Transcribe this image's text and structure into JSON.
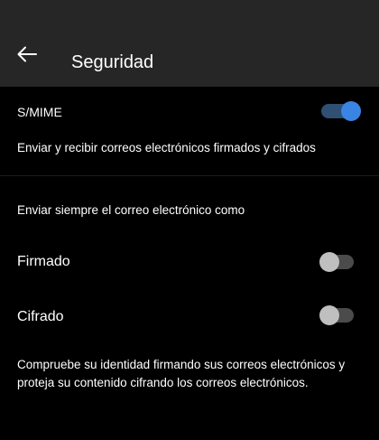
{
  "header": {
    "title": "Seguridad",
    "back_icon": "arrow-left-icon"
  },
  "smime": {
    "label": "S/MIME",
    "description": "Enviar y recibir correos electrónicos firmados y cifrados",
    "enabled": true
  },
  "send_always": {
    "heading": "Enviar siempre el correo electrónico como",
    "options": [
      {
        "label": "Firmado",
        "enabled": false
      },
      {
        "label": "Cifrado",
        "enabled": false
      }
    ]
  },
  "footnote": "Compruebe su identidad firmando sus correos electrónicos y proteja su contenido cifrando los correos electrónicos.",
  "colors": {
    "header_bg": "#262626",
    "page_bg": "#000000",
    "toggle_on_knob": "#3a84e3",
    "toggle_on_track": "#2f4f73",
    "toggle_off_knob": "#bfbfbf",
    "toggle_off_track": "#4b4b4b"
  }
}
